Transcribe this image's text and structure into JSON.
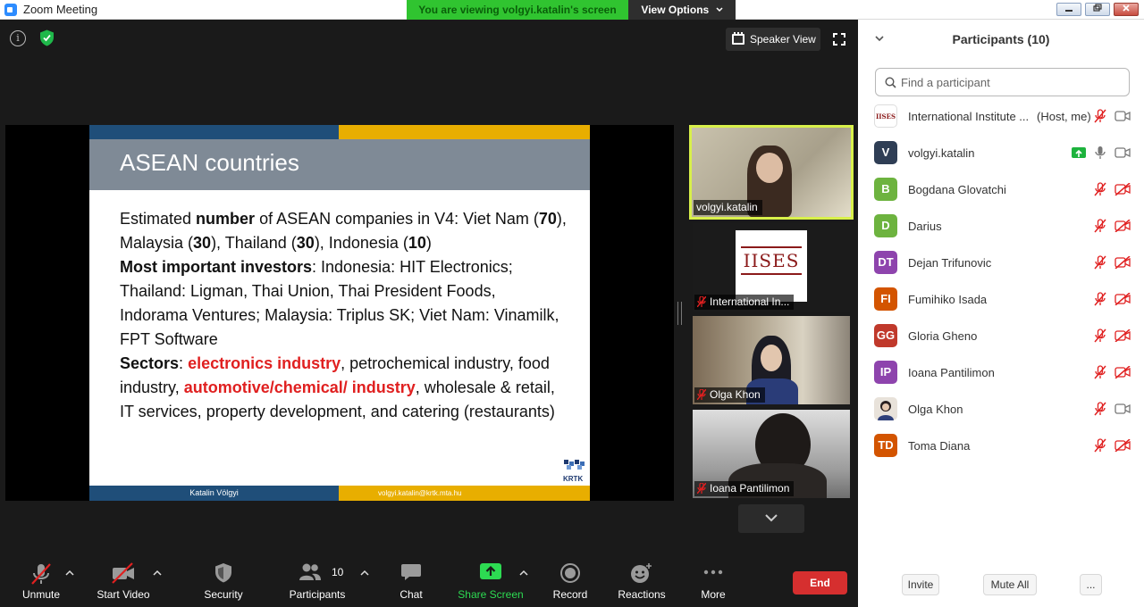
{
  "window": {
    "title": "Zoom Meeting"
  },
  "banner": {
    "viewing": "You are viewing volgyi.katalin's screen",
    "view_options": "View Options"
  },
  "top_controls": {
    "speaker_view": "Speaker View",
    "info": "i"
  },
  "slide": {
    "title": "ASEAN countries",
    "footer_author": "Katalin Völgyi",
    "footer_email": "volgyi.katalin@krtk.mta.hu",
    "logo_text": "KRTK",
    "para1": {
      "a": "Estimated ",
      "b": "number",
      "c": " of ASEAN companies in V4: Viet Nam (",
      "d": "70",
      "e": "), Malaysia (",
      "f": "30",
      "g": "), Thailand (",
      "h": "30",
      "i": "), Indonesia (",
      "j": "10",
      "k": ")"
    },
    "para2": {
      "a": "Most important investors",
      "b": ": Indonesia: HIT Electronics; Thailand: Ligman, Thai Union, Thai President Foods, Indorama Ventures;  Malaysia: Triplus SK; Viet Nam: Vinamilk, FPT Software"
    },
    "para3": {
      "a": "Sectors",
      "b": ": ",
      "c": "electronics industry",
      "d": ", petrochemical industry, food industry, ",
      "e": "automotive/chemical/ industry",
      "f": ", wholesale & retail, IT services, property development, and catering (restaurants)"
    }
  },
  "video_tiles": [
    {
      "name": "volgyi.katalin",
      "muted": false,
      "active": true
    },
    {
      "name": "International In...",
      "muted": true,
      "logo": "IISES"
    },
    {
      "name": "Olga Khon",
      "muted": true
    },
    {
      "name": "Ioana Pantilimon",
      "muted": true
    }
  ],
  "toolbar": {
    "unmute": "Unmute",
    "start_video": "Start Video",
    "security": "Security",
    "participants": "Participants",
    "participants_count": "10",
    "chat": "Chat",
    "share_screen": "Share Screen",
    "record": "Record",
    "reactions": "Reactions",
    "more": "More",
    "end": "End"
  },
  "panel": {
    "title": "Participants (10)",
    "search_placeholder": "Find a participant",
    "invite": "Invite",
    "mute_all": "Mute All",
    "more": "...",
    "participants": [
      {
        "name": "International Institute ...",
        "tag": "(Host, me)",
        "avatar": "IISES",
        "color": "#ffffff",
        "mic": "muted",
        "cam": "on"
      },
      {
        "name": "volgyi.katalin",
        "avatar": "V",
        "color": "#2f3e55",
        "mic": "on",
        "cam": "on",
        "sharing": true
      },
      {
        "name": "Bogdana Glovatchi",
        "avatar": "B",
        "color": "#6db33f",
        "mic": "muted",
        "cam": "off"
      },
      {
        "name": "Darius",
        "avatar": "D",
        "color": "#6db33f",
        "mic": "muted",
        "cam": "off"
      },
      {
        "name": "Dejan Trifunovic",
        "avatar": "DT",
        "color": "#8e44ad",
        "mic": "muted",
        "cam": "off"
      },
      {
        "name": "Fumihiko Isada",
        "avatar": "FI",
        "color": "#d35400",
        "mic": "muted",
        "cam": "off"
      },
      {
        "name": "Gloria Gheno",
        "avatar": "GG",
        "color": "#c0392b",
        "mic": "muted",
        "cam": "off"
      },
      {
        "name": "Ioana Pantilimon",
        "avatar": "IP",
        "color": "#8e44ad",
        "mic": "muted",
        "cam": "off"
      },
      {
        "name": "Olga Khon",
        "avatar": "",
        "color": "#e8e2da",
        "mic": "muted",
        "cam": "on"
      },
      {
        "name": "Toma Diana",
        "avatar": "TD",
        "color": "#d35400",
        "mic": "muted",
        "cam": "off"
      }
    ]
  },
  "colors": {
    "banner": "#30c430",
    "end": "#d62f2f",
    "accent_green": "#2ddb52",
    "muted_red": "#e02020"
  }
}
